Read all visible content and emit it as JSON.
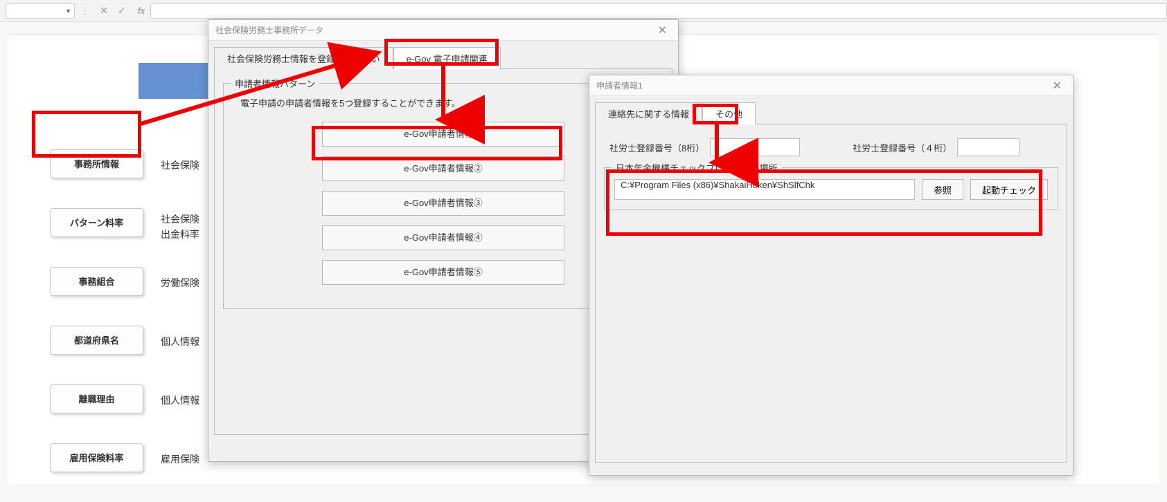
{
  "toolbar": {
    "fx": "fx"
  },
  "sidebar": {
    "items": [
      {
        "label": "事務所情報",
        "desc": "社会保険"
      },
      {
        "label": "パターン料率",
        "desc": "社会保険\n出金料率"
      },
      {
        "label": "事務組合",
        "desc": "労働保険"
      },
      {
        "label": "都道府県名",
        "desc": "個人情報"
      },
      {
        "label": "離職理由",
        "desc": "個人情報"
      },
      {
        "label": "雇用保険料率",
        "desc": "雇用保険"
      }
    ]
  },
  "dialog1": {
    "title": "社会保険労務士事務所データ",
    "tabs": {
      "t0": "社会保険労務士情報を登録して下さい",
      "t1": "e-Gov 電子申請関連"
    },
    "group": {
      "legend": "申請者情報パターン",
      "desc": "電子申請の申請者情報を5つ登録することができます。",
      "buttons": [
        "e-Gov申請者情報①",
        "e-Gov申請者情報②",
        "e-Gov申請者情報③",
        "e-Gov申請者情報④",
        "e-Gov申請者情報⑤"
      ]
    }
  },
  "dialog2": {
    "title": "申請者情報1",
    "tabs": {
      "t0": "連絡先に関する情報",
      "t1": "その他"
    },
    "fields": {
      "reg8_label": "社労士登録番号（8桁）",
      "reg4_label": "社労士登録番号（４桁）",
      "reg8_value": "",
      "reg4_value": ""
    },
    "checkprog": {
      "legend": "日本年金機構チェックプログラムの場所",
      "path": "C:¥Program Files (x86)¥ShakaiHoken¥ShSlfChk",
      "browse": "参照",
      "launch": "起動チェック"
    }
  }
}
